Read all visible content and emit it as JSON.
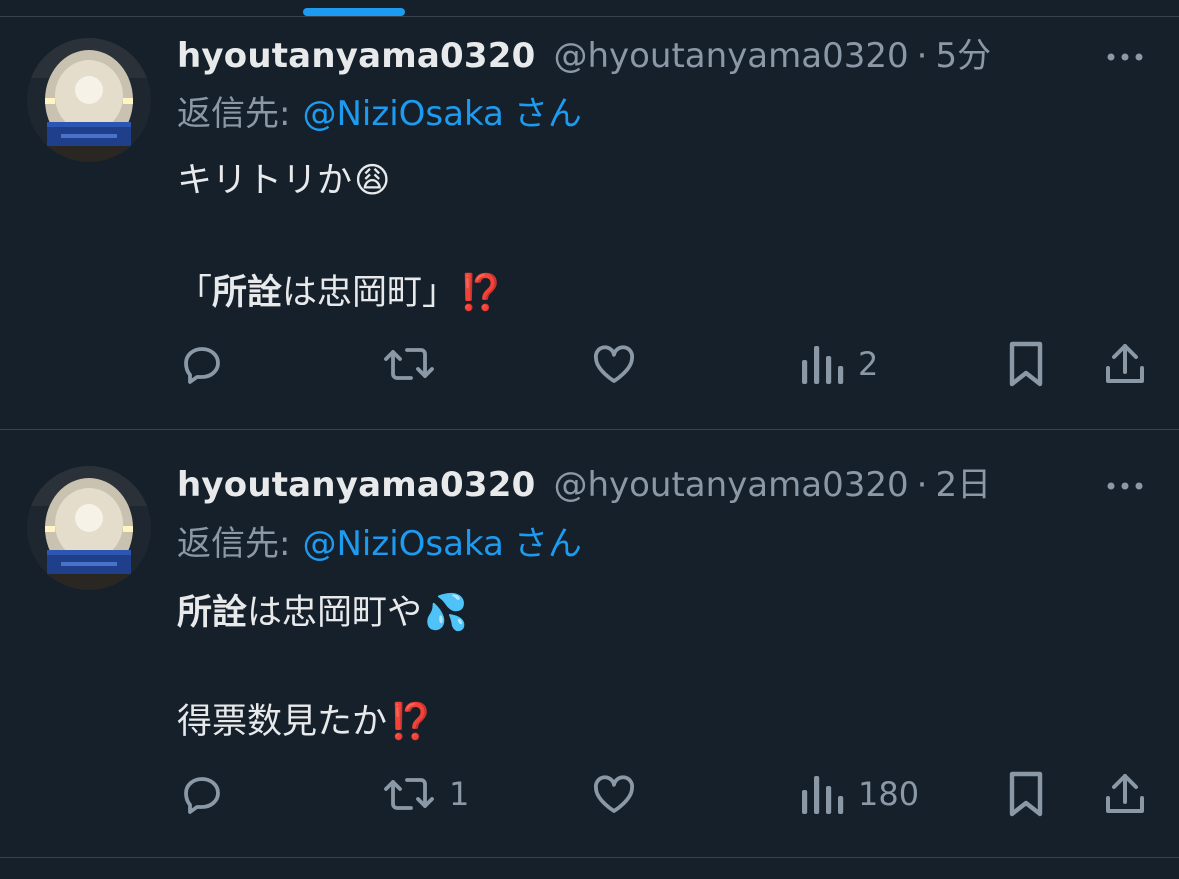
{
  "tweets": [
    {
      "display_name": "hyoutanyama0320",
      "handle": "@hyoutanyama0320",
      "separator": "·",
      "time": "5分",
      "reply_prefix": "返信先:",
      "reply_mention": "@NiziOsaka",
      "reply_suffix": "さん",
      "lines": [
        {
          "text": "キリトリか",
          "emoji": "😩"
        },
        {
          "open_bracket": "「",
          "bold": "所詮",
          "text": "は忠岡町",
          "close_bracket": "」",
          "emoji": "⁉️"
        }
      ],
      "actions": {
        "reply_count": "",
        "retweet_count": "",
        "like_count": "",
        "views_count": "2"
      }
    },
    {
      "display_name": "hyoutanyama0320",
      "handle": "@hyoutanyama0320",
      "separator": "·",
      "time": "2日",
      "reply_prefix": "返信先:",
      "reply_mention": "@NiziOsaka",
      "reply_suffix": "さん",
      "lines": [
        {
          "bold": "所詮",
          "text": "は忠岡町や",
          "emoji": "💦"
        },
        {
          "text": "得票数見たか",
          "emoji": "⁉️"
        }
      ],
      "actions": {
        "reply_count": "",
        "retweet_count": "1",
        "like_count": "",
        "views_count": "180"
      }
    }
  ],
  "icons": {
    "avatar": "shinkansen-avatar",
    "more": "more-dots-icon",
    "reply": "reply-icon",
    "retweet": "retweet-icon",
    "like": "heart-icon",
    "views": "views-bar-icon",
    "bookmark": "bookmark-icon",
    "share": "share-icon"
  },
  "colors": {
    "background": "#15202b",
    "text": "#e7e9ea",
    "secondary": "#8b98a5",
    "accent": "#1d9bf0",
    "divider": "#38444d"
  }
}
